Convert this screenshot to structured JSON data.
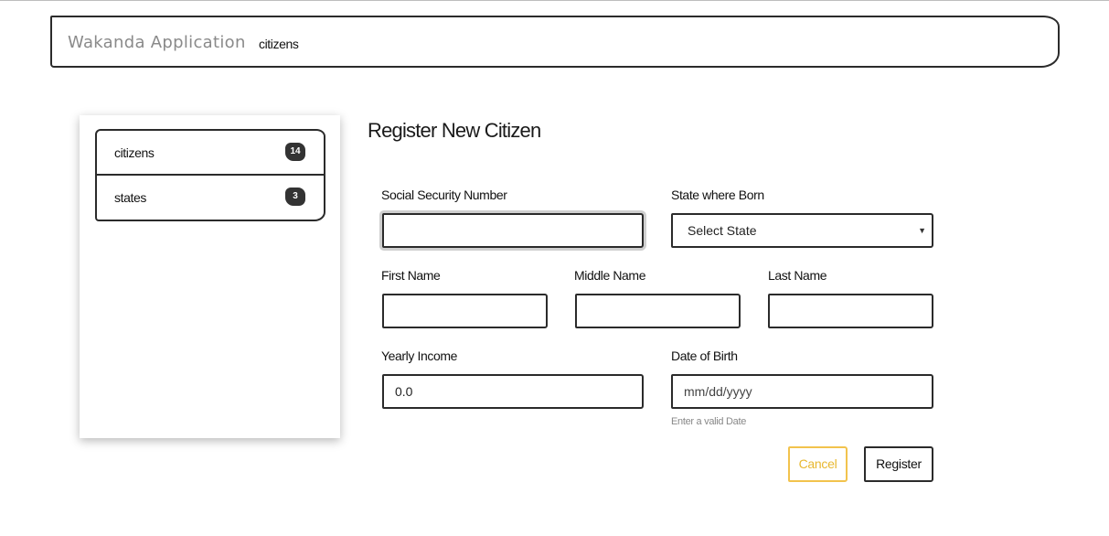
{
  "navbar": {
    "brand": "Wakanda Application",
    "link": "citizens"
  },
  "sidebar": {
    "items": [
      {
        "label": "citizens",
        "count": "14"
      },
      {
        "label": "states",
        "count": "3"
      }
    ]
  },
  "form": {
    "title": "Register New Citizen",
    "ssn": {
      "label": "Social Security Number",
      "value": ""
    },
    "state": {
      "label": "State where Born",
      "selected": "Select State"
    },
    "first_name": {
      "label": "First Name",
      "value": ""
    },
    "middle_name": {
      "label": "Middle Name",
      "value": ""
    },
    "last_name": {
      "label": "Last Name",
      "value": ""
    },
    "income": {
      "label": "Yearly Income",
      "value": "0.0"
    },
    "dob": {
      "label": "Date of Birth",
      "placeholder": "mm/dd/yyyy",
      "help": "Enter a valid Date"
    },
    "buttons": {
      "cancel": "Cancel",
      "register": "Register"
    }
  },
  "colors": {
    "border": "#2b2b2b",
    "cancel_accent": "#f2c34d",
    "badge_bg": "#333333"
  }
}
